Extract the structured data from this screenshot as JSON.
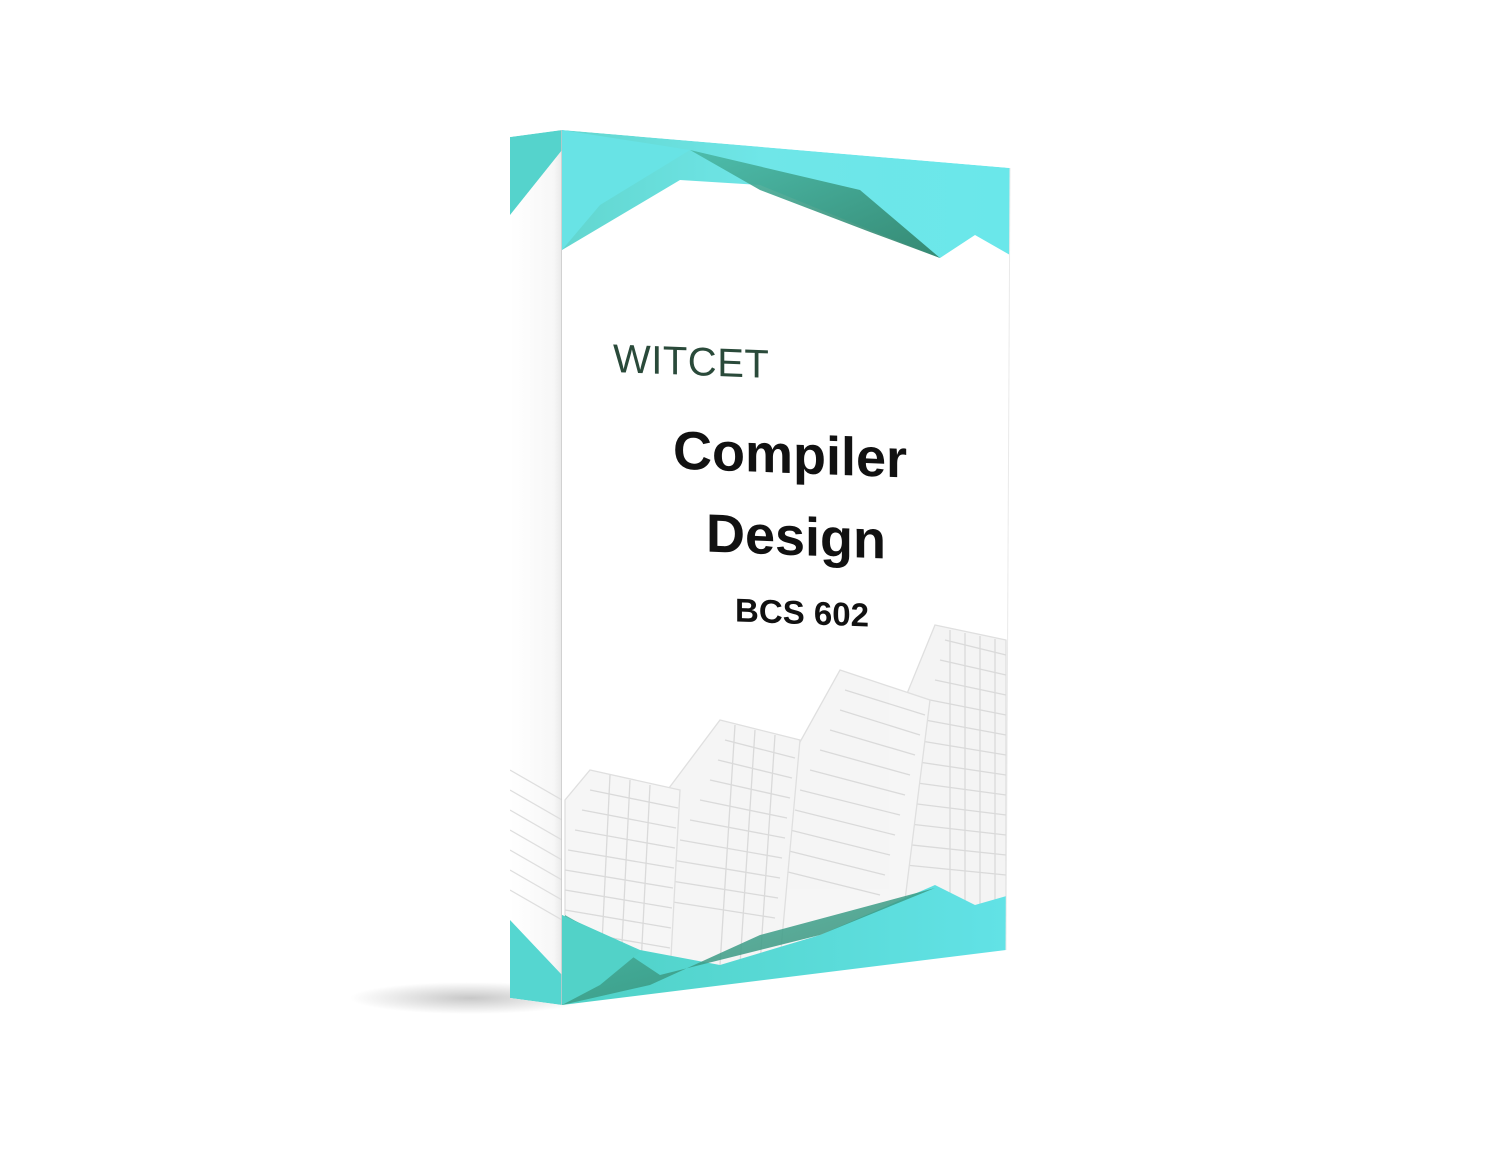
{
  "cover": {
    "brand": "WITCET",
    "title_line_1": "Compiler",
    "title_line_2": "Design",
    "course_code": "BCS 602"
  },
  "colors": {
    "accent": "#5ee3e6",
    "accent_dark": "#3d8f78",
    "accent_mid": "#4fc9c0",
    "building_lines": "#d9d9d9",
    "text": "#111111",
    "brand_text": "#2a4a3a"
  }
}
